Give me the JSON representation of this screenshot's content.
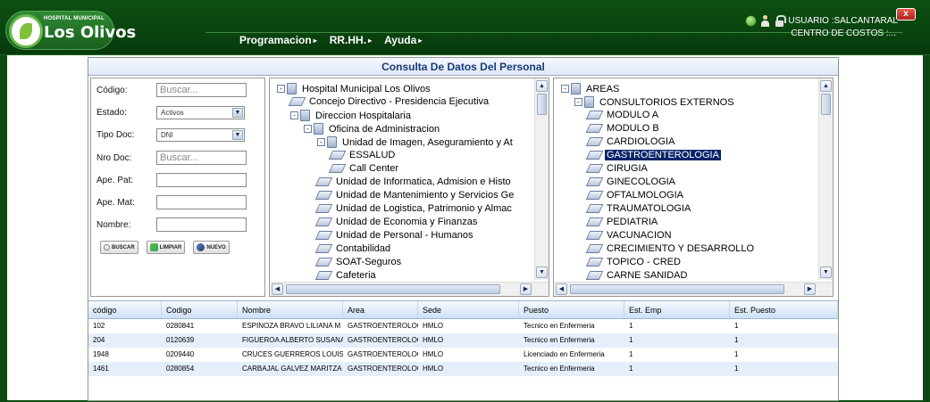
{
  "header": {
    "logo_small": "HOSPITAL MUNICIPAL",
    "logo_big": "Los Olivos",
    "user": "USUARIO :SALCANTARAL",
    "cost_center": "CENTRO DE COSTOS :...",
    "close_label": "x"
  },
  "menu": [
    {
      "label": "Programacion"
    },
    {
      "label": "RR.HH."
    },
    {
      "label": "Ayuda"
    }
  ],
  "panel": {
    "title": "Consulta De Datos Del Personal"
  },
  "filter": {
    "codigo": {
      "label": "Código:",
      "placeholder": "Buscar..."
    },
    "estado": {
      "label": "Estado:",
      "value": "Activos"
    },
    "tipo_doc": {
      "label": "Tipo Doc:",
      "value": "DNI"
    },
    "nro_doc": {
      "label": "Nro Doc:",
      "placeholder": "Buscar..."
    },
    "ape_pat": {
      "label": "Ape. Pat:"
    },
    "ape_mat": {
      "label": "Ape. Mat:"
    },
    "nombre": {
      "label": "Nombre:"
    },
    "buttons": {
      "buscar": "BUSCAR",
      "limpiar": "LIMPIAR",
      "nuevo": "NUEVO"
    }
  },
  "tree_org": [
    {
      "label": "Hospital Municipal Los Olivos",
      "level": 0,
      "type": "folder",
      "expander": "-"
    },
    {
      "label": "Concejo Directivo - Presidencia Ejecutiva",
      "level": 1,
      "type": "page"
    },
    {
      "label": "Direccion Hospitalaria",
      "level": 1,
      "type": "folder",
      "expander": "-"
    },
    {
      "label": "Oficina de Administracion",
      "level": 2,
      "type": "folder",
      "expander": "-"
    },
    {
      "label": "Unidad de Imagen, Aseguramiento y At",
      "level": 3,
      "type": "folder",
      "expander": "-"
    },
    {
      "label": "ESSALUD",
      "level": 4,
      "type": "page"
    },
    {
      "label": "Call Center",
      "level": 4,
      "type": "page"
    },
    {
      "label": "Unidad de Informatica, Admision e Histo",
      "level": 3,
      "type": "page"
    },
    {
      "label": "Unidad de Mantenimiento y Servicios Ge",
      "level": 3,
      "type": "page"
    },
    {
      "label": "Unidad de Logistica, Patrimonio y Almac",
      "level": 3,
      "type": "page"
    },
    {
      "label": "Unidad de Economia y Finanzas",
      "level": 3,
      "type": "page"
    },
    {
      "label": "Unidad de Personal - Humanos",
      "level": 3,
      "type": "page"
    },
    {
      "label": "Contabilidad",
      "level": 3,
      "type": "page"
    },
    {
      "label": "SOAT-Seguros",
      "level": 3,
      "type": "page"
    },
    {
      "label": "Cafeteria",
      "level": 3,
      "type": "page"
    }
  ],
  "tree_areas": [
    {
      "label": "AREAS",
      "level": 0,
      "type": "folder",
      "expander": "-"
    },
    {
      "label": "CONSULTORIOS EXTERNOS",
      "level": 1,
      "type": "folder",
      "expander": "-"
    },
    {
      "label": "MODULO A",
      "level": 2,
      "type": "page"
    },
    {
      "label": "MODULO B",
      "level": 2,
      "type": "page"
    },
    {
      "label": "CARDIOLOGIA",
      "level": 2,
      "type": "page"
    },
    {
      "label": "GASTROENTEROLOGIA",
      "level": 2,
      "type": "page",
      "selected": true
    },
    {
      "label": "CIRUGIA",
      "level": 2,
      "type": "page"
    },
    {
      "label": "GINECOLOGIA",
      "level": 2,
      "type": "page"
    },
    {
      "label": "OFTALMOLOGIA",
      "level": 2,
      "type": "page"
    },
    {
      "label": "TRAUMATOLOGIA",
      "level": 2,
      "type": "page"
    },
    {
      "label": "PEDIATRIA",
      "level": 2,
      "type": "page"
    },
    {
      "label": "VACUNACION",
      "level": 2,
      "type": "page"
    },
    {
      "label": "CRECIMIENTO Y DESARROLLO",
      "level": 2,
      "type": "page"
    },
    {
      "label": "TOPICO - CRED",
      "level": 2,
      "type": "page"
    },
    {
      "label": "CARNE SANIDAD",
      "level": 2,
      "type": "page"
    }
  ],
  "table": {
    "columns": [
      "código",
      "Codigo",
      "Nombre",
      "Area",
      "Sede",
      "Puesto",
      "Est. Emp",
      "Est. Puesto"
    ],
    "rows": [
      [
        "102",
        "0280841",
        "ESPINOZA BRAVO LILIANA M",
        "GASTROENTEROLOGIA",
        "HMLO",
        "Tecnico en Enfermeria",
        "1",
        "1"
      ],
      [
        "204",
        "0120639",
        "FIGUEROA ALBERTO SUSANA",
        "GASTROENTEROLOGIA",
        "HMLO",
        "Tecnico en Enfermeria",
        "1",
        "1"
      ],
      [
        "1948",
        "0209440",
        "CRUCES GUERREROS LOUIS",
        "GASTROENTEROLOGIA",
        "HMLO",
        "Licenciado en Enfermeria",
        "1",
        "1"
      ],
      [
        "1461",
        "0280854",
        "CARBAJAL GALVEZ MARITZA",
        "GASTROENTEROLOGIA",
        "HMLO",
        "Tecnico en Enfermeria",
        "1",
        "1"
      ]
    ]
  },
  "colors": {
    "header_green": "#0a4510",
    "title_blue": "#173c78",
    "selected_bg": "#0a246a",
    "row_alt": "#e5eefa"
  }
}
